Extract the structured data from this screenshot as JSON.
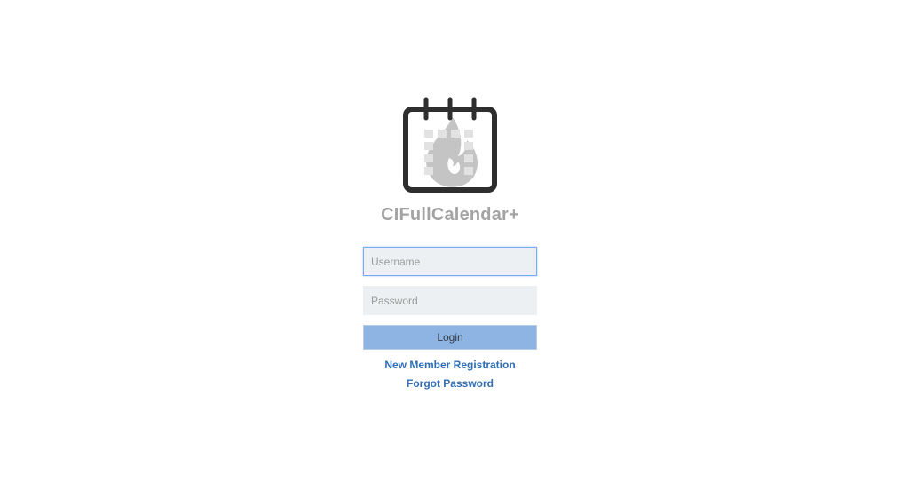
{
  "app": {
    "title": "CIFullCalendar+",
    "logo_icon": "calendar-flame-icon"
  },
  "login_form": {
    "username_placeholder": "Username",
    "password_placeholder": "Password",
    "login_label": "Login",
    "register_label": "New Member Registration",
    "forgot_label": "Forgot Password"
  },
  "colors": {
    "title": "#a3a3a3",
    "field_background": "#edf0f2",
    "focus_border": "#7aaaf0",
    "button_background": "#8db4e2",
    "link": "#2f6eb5",
    "calendar_outline": "#2e2e2e",
    "flame": "#c4c4c4"
  }
}
